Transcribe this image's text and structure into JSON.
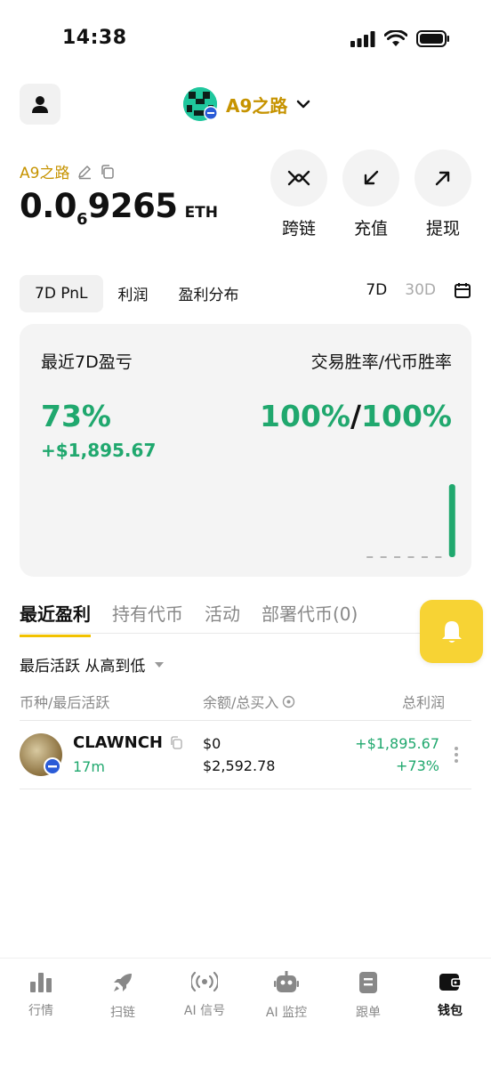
{
  "status_bar": {
    "time": "14:38"
  },
  "header": {
    "wallet_name": "A9之路"
  },
  "account": {
    "name": "A9之路",
    "balance_main": "0.0",
    "balance_subscript": "6",
    "balance_tail": "9265",
    "balance_unit": "ETH"
  },
  "actions": [
    {
      "label": "跨链",
      "icon": "bridge-icon"
    },
    {
      "label": "充值",
      "icon": "deposit-arrow-icon"
    },
    {
      "label": "提现",
      "icon": "withdraw-arrow-icon"
    }
  ],
  "pnl_tabs": {
    "items": [
      "7D PnL",
      "利润",
      "盈利分布"
    ],
    "active": "7D PnL"
  },
  "range_tabs": {
    "items": [
      "7D",
      "30D"
    ],
    "active": "7D"
  },
  "stats": {
    "pnl_label": "最近7D盈亏",
    "winrate_label": "交易胜率/代币胜率",
    "pnl_pct": "73%",
    "pnl_usd": "+$1,895.67",
    "trade_winrate": "100%",
    "separator": "/",
    "token_winrate": "100%",
    "colors": {
      "positive": "#20a86e"
    }
  },
  "chart_data": {
    "type": "bar",
    "categories": [
      "",
      "",
      "",
      "",
      "",
      "",
      ""
    ],
    "values": [
      0,
      0,
      0,
      0,
      0,
      0,
      1895.67
    ],
    "title": "",
    "xlabel": "",
    "ylabel": "",
    "grid": false
  },
  "list_tabs": {
    "items": [
      "最近盈利",
      "持有代币",
      "活动",
      "部署代币(0)"
    ],
    "active": "最近盈利"
  },
  "sort": {
    "label": "最后活跃 从高到低"
  },
  "columns": {
    "token": "币种/最后活跃",
    "balance": "余额/总买入",
    "pnl": "总利润"
  },
  "tokens": [
    {
      "symbol": "CLAWNCH",
      "age": "17m",
      "balance": "$0",
      "total_buy": "$2,592.78",
      "pnl": "+$1,895.67",
      "pnl_pct": "+73%"
    }
  ],
  "bottom_nav": [
    {
      "label": "行情",
      "icon": "market-chart-icon"
    },
    {
      "label": "扫链",
      "icon": "rocket-icon"
    },
    {
      "label": "AI 信号",
      "icon": "signal-icon"
    },
    {
      "label": "AI 监控",
      "icon": "robot-icon"
    },
    {
      "label": "跟单",
      "icon": "document-icon"
    },
    {
      "label": "钱包",
      "icon": "wallet-icon"
    }
  ],
  "active_nav": "钱包"
}
